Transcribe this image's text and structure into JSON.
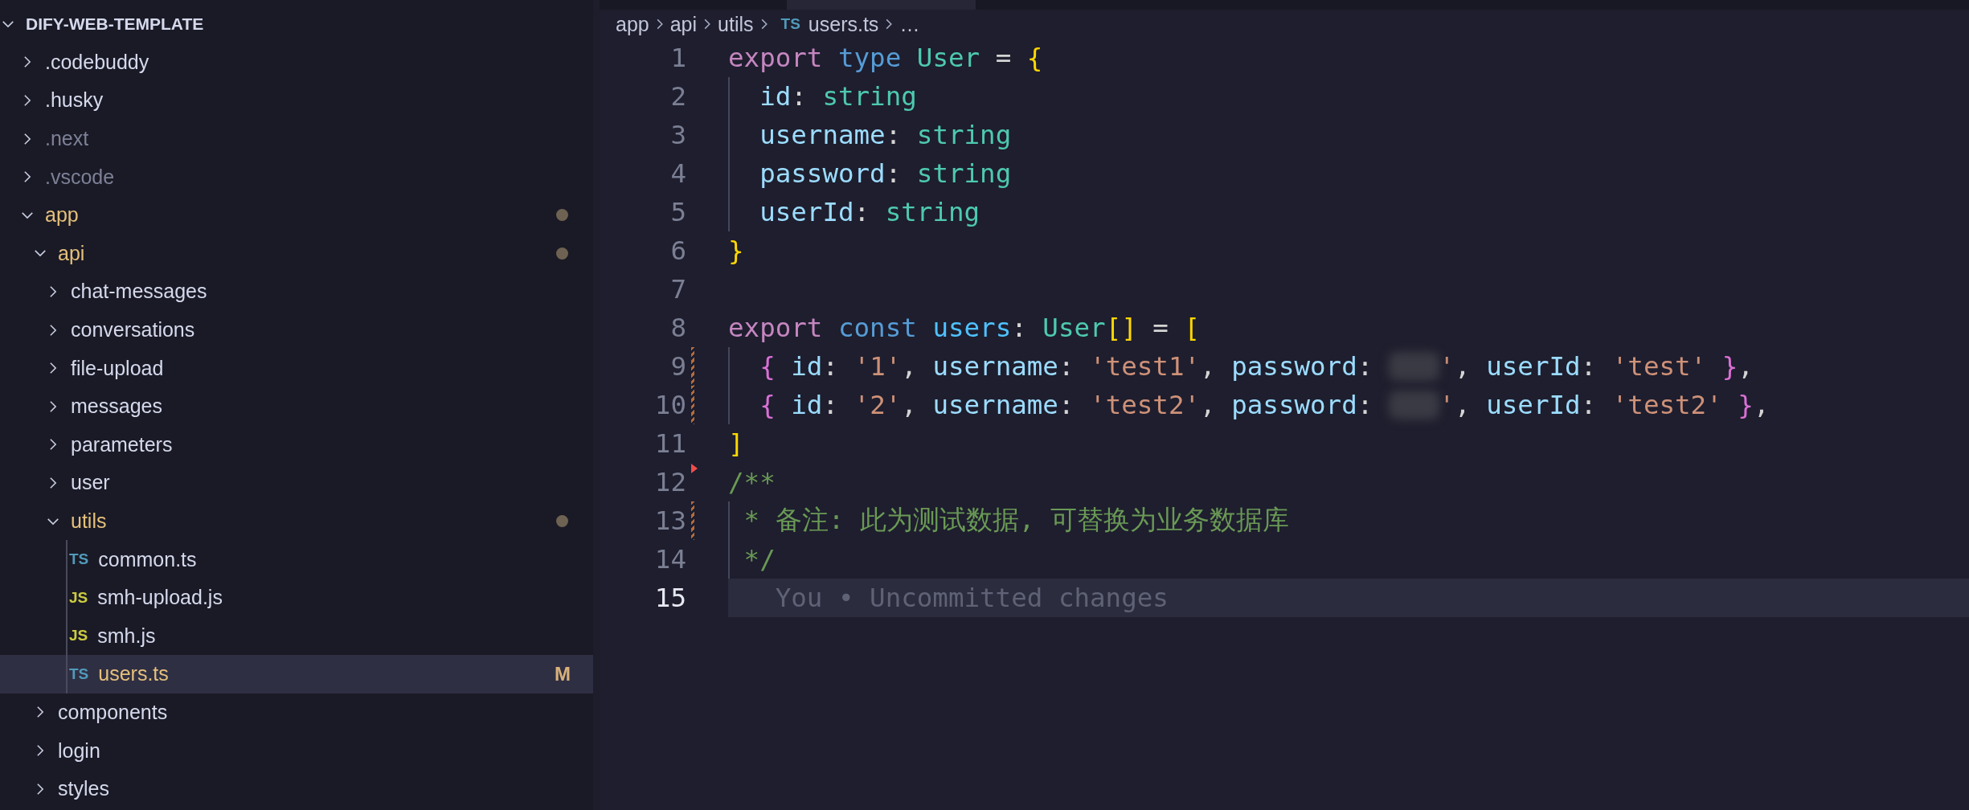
{
  "explorer": {
    "title": "DIFY-WEB-TEMPLATE",
    "expanded": true,
    "items": [
      {
        "kind": "folder",
        "name": ".codebuddy",
        "expanded": false,
        "selected": false
      },
      {
        "kind": "folder",
        "name": ".husky",
        "expanded": false,
        "selected": false
      },
      {
        "kind": "folder",
        "name": ".next",
        "expanded": false,
        "ignored": true,
        "selected": false
      },
      {
        "kind": "folder",
        "name": ".vscode",
        "expanded": false,
        "ignored": true,
        "selected": false
      },
      {
        "kind": "folder",
        "name": "app",
        "expanded": true,
        "modified": true,
        "selected": false,
        "children": [
          {
            "kind": "folder",
            "name": "api",
            "expanded": true,
            "modified": true,
            "selected": false,
            "children": [
              {
                "kind": "folder",
                "name": "chat-messages",
                "expanded": false,
                "selected": false
              },
              {
                "kind": "folder",
                "name": "conversations",
                "expanded": false,
                "selected": false
              },
              {
                "kind": "folder",
                "name": "file-upload",
                "expanded": false,
                "selected": false
              },
              {
                "kind": "folder",
                "name": "messages",
                "expanded": false,
                "selected": false
              },
              {
                "kind": "folder",
                "name": "parameters",
                "expanded": false,
                "selected": false
              },
              {
                "kind": "folder",
                "name": "user",
                "expanded": false,
                "selected": false
              },
              {
                "kind": "folder",
                "name": "utils",
                "expanded": true,
                "modified": true,
                "guide": true,
                "selected": false,
                "children": [
                  {
                    "kind": "file",
                    "icon": "TS",
                    "color": "#519aba",
                    "name": "common.ts",
                    "selected": false
                  },
                  {
                    "kind": "file",
                    "icon": "JS",
                    "color": "#cbcb41",
                    "name": "smh-upload.js",
                    "selected": false
                  },
                  {
                    "kind": "file",
                    "icon": "JS",
                    "color": "#cbcb41",
                    "name": "smh.js",
                    "selected": false
                  },
                  {
                    "kind": "file",
                    "icon": "TS",
                    "color": "#519aba",
                    "name": "users.ts",
                    "modified": true,
                    "badge": "M",
                    "selected": true
                  }
                ]
              }
            ]
          },
          {
            "kind": "folder",
            "name": "components",
            "expanded": false,
            "selected": false
          },
          {
            "kind": "folder",
            "name": "login",
            "expanded": false,
            "selected": false
          },
          {
            "kind": "folder",
            "name": "styles",
            "expanded": false,
            "selected": false
          }
        ]
      }
    ]
  },
  "editor": {
    "breadcrumb": [
      {
        "kind": "folder",
        "text": "app"
      },
      {
        "kind": "folder",
        "text": "api"
      },
      {
        "kind": "folder",
        "text": "utils"
      },
      {
        "kind": "file",
        "icon": "TS",
        "text": "users.ts"
      },
      {
        "kind": "more",
        "text": "…"
      }
    ],
    "lines": [
      {
        "number": "1",
        "tokens": [
          {
            "kind": "keyword",
            "text": "export "
          },
          {
            "kind": "storage",
            "text": "type "
          },
          {
            "kind": "type",
            "text": "User"
          },
          {
            "kind": "punct",
            "text": " = "
          },
          {
            "kind": "bracket",
            "text": "{"
          }
        ]
      },
      {
        "number": "2",
        "guide": true,
        "tokens": [
          {
            "kind": "property",
            "text": "  id"
          },
          {
            "kind": "punct",
            "text": ": "
          },
          {
            "kind": "type",
            "text": "string"
          }
        ]
      },
      {
        "number": "3",
        "guide": true,
        "tokens": [
          {
            "kind": "property",
            "text": "  username"
          },
          {
            "kind": "punct",
            "text": ": "
          },
          {
            "kind": "type",
            "text": "string"
          }
        ]
      },
      {
        "number": "4",
        "guide": true,
        "tokens": [
          {
            "kind": "property",
            "text": "  password"
          },
          {
            "kind": "punct",
            "text": ": "
          },
          {
            "kind": "type",
            "text": "string"
          }
        ]
      },
      {
        "number": "5",
        "guide": true,
        "tokens": [
          {
            "kind": "property",
            "text": "  userId"
          },
          {
            "kind": "punct",
            "text": ": "
          },
          {
            "kind": "type",
            "text": "string"
          }
        ]
      },
      {
        "number": "6",
        "tokens": [
          {
            "kind": "bracket",
            "text": "}"
          }
        ]
      },
      {
        "number": "7"
      },
      {
        "number": "8",
        "tokens": [
          {
            "kind": "keyword",
            "text": "export "
          },
          {
            "kind": "storage",
            "text": "const "
          },
          {
            "kind": "variable",
            "text": "users"
          },
          {
            "kind": "punct",
            "text": ": "
          },
          {
            "kind": "type",
            "text": "User"
          },
          {
            "kind": "bracket",
            "text": "[]"
          },
          {
            "kind": "punct",
            "text": " = "
          },
          {
            "kind": "bracket",
            "text": "["
          }
        ]
      },
      {
        "number": "9",
        "guide": true,
        "modified": true,
        "tokens": [
          {
            "kind": "brace",
            "text": "  { "
          },
          {
            "kind": "property",
            "text": "id"
          },
          {
            "kind": "punct",
            "text": ": "
          },
          {
            "kind": "string",
            "text": "'1'"
          },
          {
            "kind": "punct",
            "text": ", "
          },
          {
            "kind": "property",
            "text": "username"
          },
          {
            "kind": "punct",
            "text": ": "
          },
          {
            "kind": "string",
            "text": "'test1'"
          },
          {
            "kind": "punct",
            "text": ", "
          },
          {
            "kind": "property",
            "text": "password"
          },
          {
            "kind": "punct",
            "text": ": "
          },
          {
            "kind": "redacted"
          },
          {
            "kind": "string",
            "text": "'"
          },
          {
            "kind": "punct",
            "text": ", "
          },
          {
            "kind": "property",
            "text": "userId"
          },
          {
            "kind": "punct",
            "text": ": "
          },
          {
            "kind": "string",
            "text": "'test' "
          },
          {
            "kind": "brace",
            "text": "}"
          },
          {
            "kind": "punct",
            "text": ","
          }
        ]
      },
      {
        "number": "10",
        "guide": true,
        "modified": true,
        "tokens": [
          {
            "kind": "brace",
            "text": "  { "
          },
          {
            "kind": "property",
            "text": "id"
          },
          {
            "kind": "punct",
            "text": ": "
          },
          {
            "kind": "string",
            "text": "'2'"
          },
          {
            "kind": "punct",
            "text": ", "
          },
          {
            "kind": "property",
            "text": "username"
          },
          {
            "kind": "punct",
            "text": ": "
          },
          {
            "kind": "string",
            "text": "'test2'"
          },
          {
            "kind": "punct",
            "text": ", "
          },
          {
            "kind": "property",
            "text": "password"
          },
          {
            "kind": "punct",
            "text": ": "
          },
          {
            "kind": "redacted"
          },
          {
            "kind": "string",
            "text": "'"
          },
          {
            "kind": "punct",
            "text": ", "
          },
          {
            "kind": "property",
            "text": "userId"
          },
          {
            "kind": "punct",
            "text": ": "
          },
          {
            "kind": "string",
            "text": "'test2' "
          },
          {
            "kind": "brace",
            "text": "}"
          },
          {
            "kind": "punct",
            "text": ","
          }
        ]
      },
      {
        "number": "11",
        "tokens": [
          {
            "kind": "bracket",
            "text": "]"
          }
        ]
      },
      {
        "number": "12",
        "deleted": true,
        "tokens": [
          {
            "kind": "comment",
            "text": "/**"
          }
        ]
      },
      {
        "number": "13",
        "guide": true,
        "modified": true,
        "tokens": [
          {
            "kind": "comment",
            "text": " * 备注: 此为测试数据, 可替换为业务数据库"
          }
        ]
      },
      {
        "number": "14",
        "guide": true,
        "tokens": [
          {
            "kind": "comment",
            "text": " */"
          }
        ]
      },
      {
        "number": "15",
        "current": true,
        "blame": "You • Uncommitted changes"
      }
    ]
  }
}
